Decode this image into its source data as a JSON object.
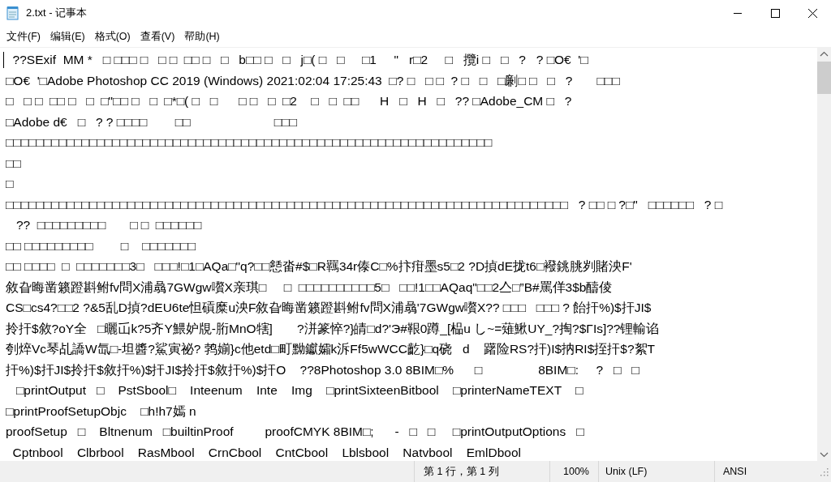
{
  "window": {
    "title": "2.txt - 记事本"
  },
  "menu": [
    {
      "label": "文件(F)"
    },
    {
      "label": "编辑(E)"
    },
    {
      "label": "格式(O)"
    },
    {
      "label": "查看(V)"
    },
    {
      "label": "帮助(H)"
    }
  ],
  "editor": {
    "lines": [
      "  ??SExif  MM *   □ □□□ □   □ □  □□ □   □   b□□ □   □   j□( □   □     □1     \"   r□2     □   攬i □   □   ?   ? □O€  '□",
      "□O€  '□Adobe Photoshop CC 2019 (Windows) 2021:02:04 17:25:43  □? □   □ □  ? □   □   □劆□ □   □   ?       □□□",
      "□   □ □  □□ □   □  □\"□□ □   □  □*□( □   □      □ □   □  □2    □   □  □□      H   □   H   □   ?? □Adobe_CM □   ?",
      "□Adobe d€   □   ? ? □□□□        □□                        □□□",
      "□□□□□□□□□□□□□□□□□□□□□□□□□□□□□□□□□□□□□□□□□□□□□□□□□□□□□□□□□□□□□□□□",
      "□□",
      "□",
      "□□□□□□□□□□□□□□□□□□□□□□□□□□□□□□□□□□□□□□□□□□□□□□□□□□□□□□□□□□□□□□□□□□□□□□□□□□   ? □□ □ ?□\"   □□□□□□   ? □",
      "   ??  □□□□□□□□□       □ □  □□□□□□",
      "□□ □□□□□□□□□        □    □□□□□□□",
      "□□ □□□□  □  □□□□□□□3□   □□□!□1□AQa□\"q?□□懖畓#$□R羈34r傣C□%抃疳墨s5□2 ?D揁dE拢t6□襏銚朓刿賭泱F'",
      "敘旮晦凿籁蹬斟鲋fv問X浦骉7GWgw嚽X亲琪□     □  □□□□□□□□□□5□   □□!1□□AQaq\"□□2亼□”B#罵佯3$b醻倰",
      "CS□cs4?□□2 ?&5乱D揁?dEU6te怛碽糜u泱F敘旮晦凿籁蹬斟鲋fv問X浦骉'7GWgw嚽X?? □□□   □□□ ? 飴扞%)$扞JI$",
      "拎扞$敘?oY全   □曬屲k?5齐Y鰃妒覑-胻MnO犗]       ?洴篆悴?}皘□d?'Э#鞎0蹲_[榀u し~=薙鰍UY_?掏?$ΓIs]??锂輸谄",
      "刳焠Vc琴乩譑W氙□-坦醬?鯊寅祕? 鹁媊}c他etd□町黝钀孀k泝Ff5wWCC齕}□q硗   d    躇险RS?扞)I$抐RI$挃扞$?絮T",
      "扞%)$扞JI$拎扞$敘扞%)$扞JI$拎扞$敘扞%)$扞O    ??8Photoshop 3.0 8BIM□%      □                8BIM□:     ?   □   □",
      "   □printOutput   □    PstSbool□    Inteenum    Inte    Img    □printSixteenBitbool    □printerNameTEXT    □",
      "□printProofSetupObjc    □h!h7嫣 n",
      "proofSetup   □    Bltnenum   □builtinProof         proofCMYK 8BIM□;      -   □   □     □printOutputOptions   □",
      "  Cptnbool    Clbrbool    RasMbool    CrnCbool    CntCbool    Lblsbool    Natvbool    EmlDbool"
    ]
  },
  "status_bar": {
    "position": "第 1 行，第 1 列",
    "zoom": "100%",
    "line_ending": "Unix (LF)",
    "encoding": "ANSI"
  }
}
